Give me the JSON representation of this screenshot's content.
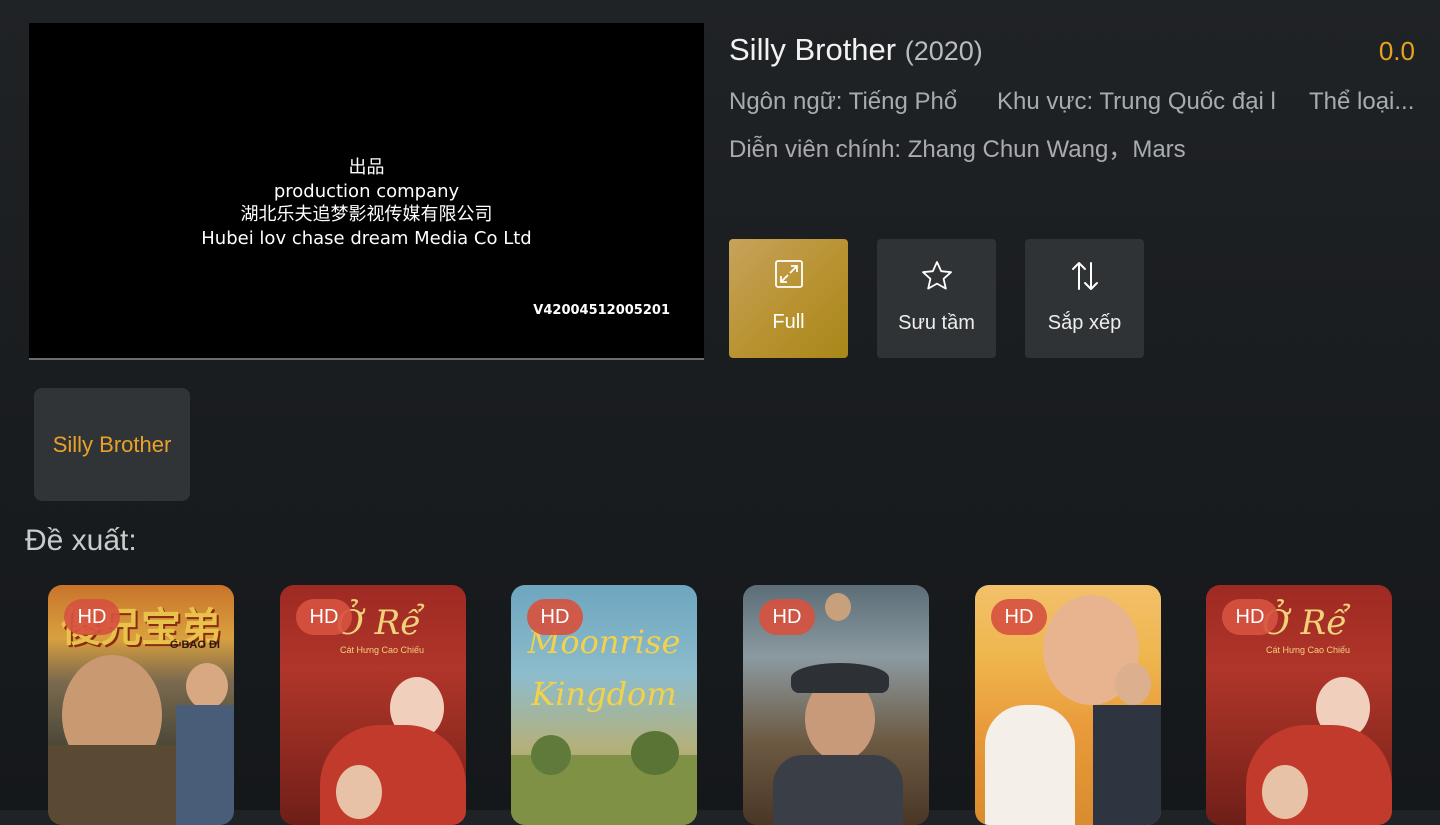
{
  "player": {
    "credit_lines": [
      "出品",
      "production company",
      "湖北乐夫追梦影视传媒有限公司",
      "Hubei lov chase dream Media Co Ltd"
    ],
    "code": "V42004512005201"
  },
  "details": {
    "title": "Silly Brother",
    "year": "(2020)",
    "rating": "0.0",
    "language": "Ngôn ngữ: Tiếng Phổ",
    "region": "Khu vực: Trung Quốc đại l",
    "genre": "Thể loại...",
    "cast": "Diễn viên chính: Zhang Chun Wang，Mars"
  },
  "actions": {
    "full_label": "Full",
    "collect_label": "Sưu tầm",
    "sort_label": "Sắp xếp"
  },
  "episodes": [
    {
      "label": "Silly Brother"
    }
  ],
  "recommend": {
    "title": "Đề xuất:",
    "items": [
      {
        "badge": "HD",
        "poster_text": "傻兄宝弟",
        "poster_subtext": "G BAO DI"
      },
      {
        "badge": "HD",
        "poster_text": "Ở Rể",
        "poster_subtext": "Cát Hưng Cao Chiếu"
      },
      {
        "badge": "HD",
        "poster_text": "Moonrise",
        "poster_subtext": "Kingdom"
      },
      {
        "badge": "HD",
        "poster_text": "",
        "poster_subtext": ""
      },
      {
        "badge": "HD",
        "poster_text": "",
        "poster_subtext": ""
      },
      {
        "badge": "HD",
        "poster_text": "Ở Rể",
        "poster_subtext": "Cát Hưng Cao Chiếu"
      }
    ]
  },
  "colors": {
    "accent_orange": "#e9a21d",
    "active_button_gold": "#b8922f",
    "hd_badge": "#d65240",
    "background": "#1d2023"
  },
  "icons": {
    "full": "expand-icon",
    "collect": "star-icon",
    "sort": "sort-arrows-icon"
  }
}
